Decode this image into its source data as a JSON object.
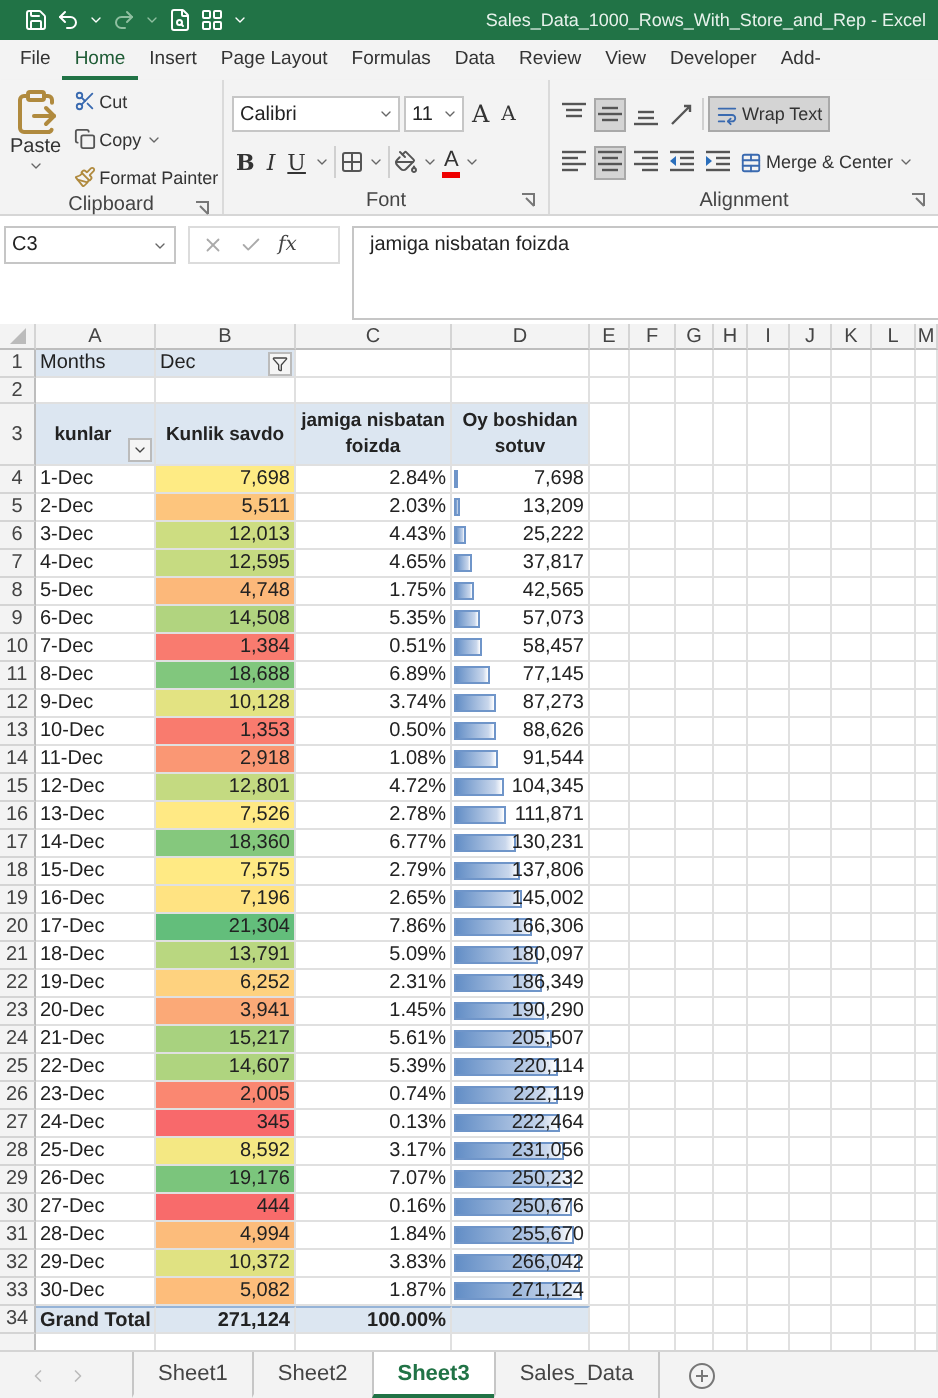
{
  "window": {
    "title": "Sales_Data_1000_Rows_With_Store_and_Rep  -  Excel"
  },
  "ribbon_tabs": [
    {
      "label": "File",
      "selected": false
    },
    {
      "label": "Home",
      "selected": true
    },
    {
      "label": "Insert",
      "selected": false
    },
    {
      "label": "Page Layout",
      "selected": false
    },
    {
      "label": "Formulas",
      "selected": false
    },
    {
      "label": "Data",
      "selected": false
    },
    {
      "label": "Review",
      "selected": false
    },
    {
      "label": "View",
      "selected": false
    },
    {
      "label": "Developer",
      "selected": false
    },
    {
      "label": "Add-",
      "selected": false
    }
  ],
  "clipboard": {
    "paste": "Paste",
    "cut": "Cut",
    "copy": "Copy",
    "format_painter": "Format Painter",
    "label": "Clipboard"
  },
  "font": {
    "name": "Calibri",
    "size": "11",
    "grow": "A",
    "shrink": "A",
    "bold": "B",
    "italic": "I",
    "underline": "U",
    "color_letter": "A",
    "label": "Font"
  },
  "alignment": {
    "buttons": [
      {
        "kind": "top",
        "selected": false
      },
      {
        "kind": "middle",
        "selected": true
      },
      {
        "kind": "bottom",
        "selected": false
      },
      {
        "kind": "orientation",
        "selected": false
      },
      {
        "kind": "left",
        "selected": false
      },
      {
        "kind": "center",
        "selected": true
      },
      {
        "kind": "right",
        "selected": false
      },
      {
        "kind": "outdent",
        "selected": false
      },
      {
        "kind": "indent",
        "selected": false
      }
    ],
    "wrap_text": {
      "label": "Wrap Text",
      "on": true
    },
    "merge": "Merge & Center",
    "label": "Alignment"
  },
  "formula_bar": {
    "name_box": "C3",
    "function_label": "fx",
    "value": "jamiga nisbatan foizda"
  },
  "columns": [
    "A",
    "B",
    "C",
    "D",
    "E",
    "F",
    "G",
    "H",
    "I",
    "J",
    "K",
    "L",
    "M"
  ],
  "pivot": {
    "filter": {
      "row": "1",
      "label": "Months",
      "value": "Dec"
    },
    "empty_row": "2",
    "header": {
      "row": "3",
      "columns": [
        "kunlar",
        "Kunlik savdo",
        "jamiga nisbatan foizda",
        "Oy boshidan sotuv"
      ]
    },
    "rows": [
      {
        "row": "4",
        "day": "1-Dec",
        "sales": "7,698",
        "color": "#feeb84",
        "share": "2.84%",
        "cumulative": "7,698",
        "level": 0.028
      },
      {
        "row": "5",
        "day": "2-Dec",
        "sales": "5,511",
        "color": "#fdc57d",
        "share": "2.03%",
        "cumulative": "13,209",
        "level": 0.049
      },
      {
        "row": "6",
        "day": "3-Dec",
        "sales": "12,013",
        "color": "#cddd81",
        "share": "4.43%",
        "cumulative": "25,222",
        "level": 0.093
      },
      {
        "row": "7",
        "day": "4-Dec",
        "sales": "12,595",
        "color": "#c6db81",
        "share": "4.65%",
        "cumulative": "37,817",
        "level": 0.139
      },
      {
        "row": "8",
        "day": "5-Dec",
        "sales": "4,748",
        "color": "#fcb87a",
        "share": "1.75%",
        "cumulative": "42,565",
        "level": 0.157
      },
      {
        "row": "9",
        "day": "6-Dec",
        "sales": "14,508",
        "color": "#b1d47f",
        "share": "5.35%",
        "cumulative": "57,073",
        "level": 0.21
      },
      {
        "row": "10",
        "day": "7-Dec",
        "sales": "1,384",
        "color": "#f97b6f",
        "share": "0.51%",
        "cumulative": "58,457",
        "level": 0.216
      },
      {
        "row": "11",
        "day": "8-Dec",
        "sales": "18,688",
        "color": "#81c77d",
        "share": "6.89%",
        "cumulative": "77,145",
        "level": 0.285
      },
      {
        "row": "12",
        "day": "9-Dec",
        "sales": "10,128",
        "color": "#e3e382",
        "share": "3.74%",
        "cumulative": "87,273",
        "level": 0.322
      },
      {
        "row": "13",
        "day": "10-Dec",
        "sales": "1,353",
        "color": "#f97b6e",
        "share": "0.50%",
        "cumulative": "88,626",
        "level": 0.327
      },
      {
        "row": "14",
        "day": "11-Dec",
        "sales": "2,918",
        "color": "#fa9774",
        "share": "1.08%",
        "cumulative": "91,544",
        "level": 0.338
      },
      {
        "row": "15",
        "day": "12-Dec",
        "sales": "12,801",
        "color": "#c4da81",
        "share": "4.72%",
        "cumulative": "104,345",
        "level": 0.385
      },
      {
        "row": "16",
        "day": "13-Dec",
        "sales": "7,526",
        "color": "#ffe984",
        "share": "2.78%",
        "cumulative": "111,871",
        "level": 0.413
      },
      {
        "row": "17",
        "day": "14-Dec",
        "sales": "18,360",
        "color": "#85c87d",
        "share": "6.77%",
        "cumulative": "130,231",
        "level": 0.48
      },
      {
        "row": "18",
        "day": "15-Dec",
        "sales": "7,575",
        "color": "#ffea84",
        "share": "2.79%",
        "cumulative": "137,806",
        "level": 0.508
      },
      {
        "row": "19",
        "day": "16-Dec",
        "sales": "7,196",
        "color": "#ffe382",
        "share": "2.65%",
        "cumulative": "145,002",
        "level": 0.535
      },
      {
        "row": "20",
        "day": "17-Dec",
        "sales": "21,304",
        "color": "#63be7b",
        "share": "7.86%",
        "cumulative": "166,306",
        "level": 0.613
      },
      {
        "row": "21",
        "day": "18-Dec",
        "sales": "13,791",
        "color": "#b9d780",
        "share": "5.09%",
        "cumulative": "180,097",
        "level": 0.664
      },
      {
        "row": "22",
        "day": "19-Dec",
        "sales": "6,252",
        "color": "#fed27f",
        "share": "2.31%",
        "cumulative": "186,349",
        "level": 0.687
      },
      {
        "row": "23",
        "day": "20-Dec",
        "sales": "3,941",
        "color": "#fba977",
        "share": "1.45%",
        "cumulative": "190,290",
        "level": 0.702
      },
      {
        "row": "24",
        "day": "21-Dec",
        "sales": "15,217",
        "color": "#a8d27f",
        "share": "5.61%",
        "cumulative": "205,507",
        "level": 0.758
      },
      {
        "row": "25",
        "day": "22-Dec",
        "sales": "14,607",
        "color": "#afd47f",
        "share": "5.39%",
        "cumulative": "220,114",
        "level": 0.812
      },
      {
        "row": "26",
        "day": "23-Dec",
        "sales": "2,005",
        "color": "#fa8771",
        "share": "0.74%",
        "cumulative": "222,119",
        "level": 0.819
      },
      {
        "row": "27",
        "day": "24-Dec",
        "sales": "345",
        "color": "#f8696b",
        "share": "0.13%",
        "cumulative": "222,464",
        "level": 0.821
      },
      {
        "row": "28",
        "day": "25-Dec",
        "sales": "8,592",
        "color": "#f4e883",
        "share": "3.17%",
        "cumulative": "231,056",
        "level": 0.852
      },
      {
        "row": "29",
        "day": "26-Dec",
        "sales": "19,176",
        "color": "#7bc57c",
        "share": "7.07%",
        "cumulative": "250,232",
        "level": 0.923
      },
      {
        "row": "30",
        "day": "27-Dec",
        "sales": "444",
        "color": "#f86b6b",
        "share": "0.16%",
        "cumulative": "250,676",
        "level": 0.925
      },
      {
        "row": "31",
        "day": "28-Dec",
        "sales": "4,994",
        "color": "#fcbc7b",
        "share": "1.84%",
        "cumulative": "255,670",
        "level": 0.943
      },
      {
        "row": "32",
        "day": "29-Dec",
        "sales": "10,372",
        "color": "#e0e282",
        "share": "3.83%",
        "cumulative": "266,042",
        "level": 0.981
      },
      {
        "row": "33",
        "day": "30-Dec",
        "sales": "5,082",
        "color": "#fdbd7b",
        "share": "1.87%",
        "cumulative": "271,124",
        "level": 1
      }
    ],
    "total": {
      "row": "34",
      "label": "Grand Total",
      "sales": "271,124",
      "share": "100.00%"
    }
  },
  "sheets": [
    {
      "label": "Sheet1",
      "selected": false
    },
    {
      "label": "Sheet2",
      "selected": false
    },
    {
      "label": "Sheet3",
      "selected": true
    },
    {
      "label": "Sales_Data",
      "selected": false
    }
  ]
}
